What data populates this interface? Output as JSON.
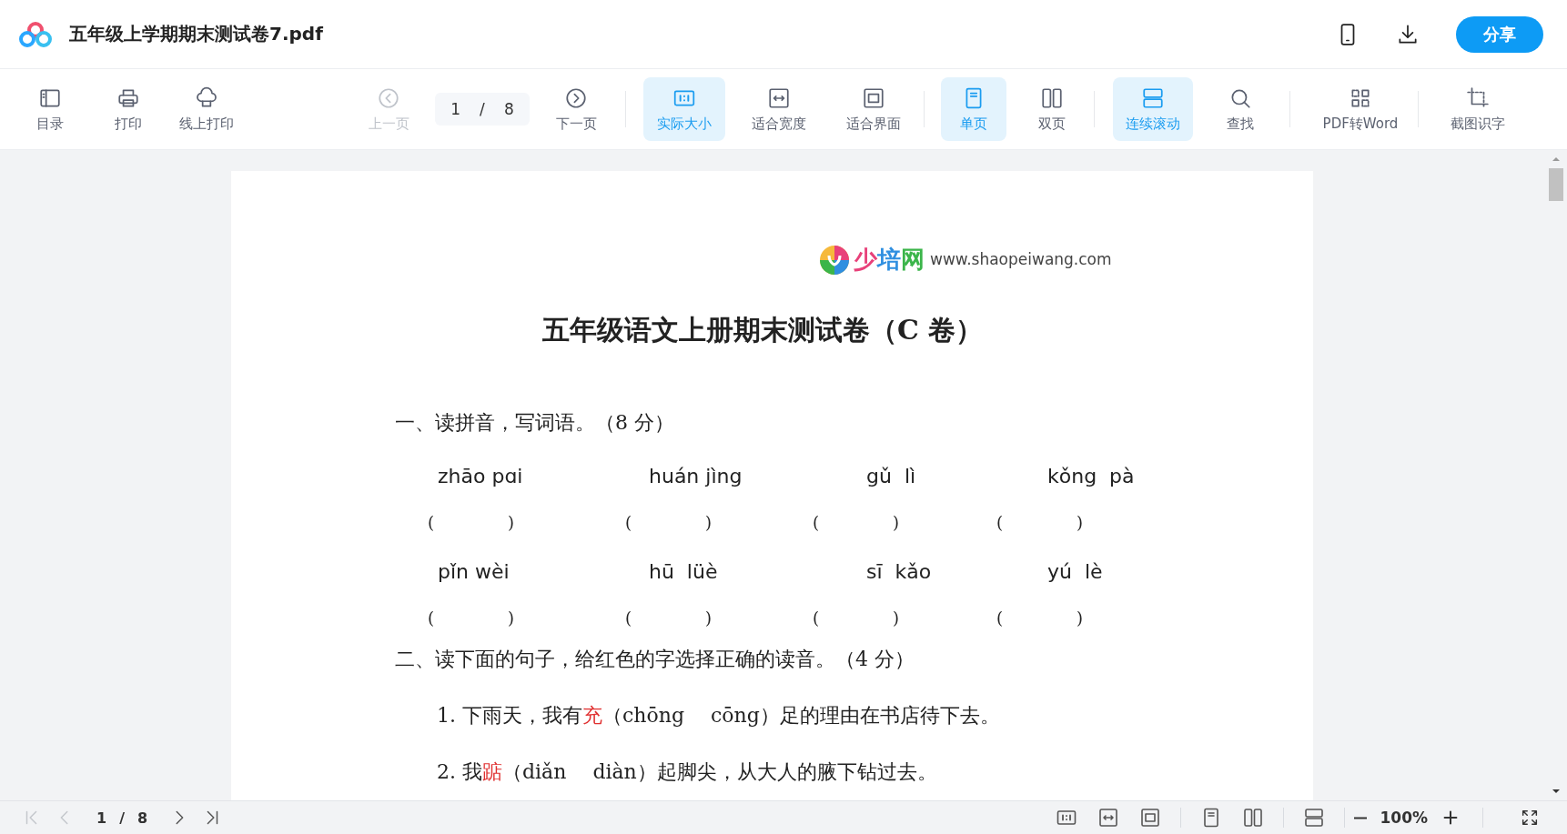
{
  "header": {
    "title": "五年级上学期期末测试卷7.pdf",
    "share_button": "分享"
  },
  "toolbar": {
    "groups": [
      [
        {
          "kind": "button",
          "label": "目录",
          "selected": false,
          "disabled": false
        },
        {
          "kind": "button",
          "label": "打印",
          "selected": false,
          "disabled": false
        },
        {
          "kind": "button",
          "label": "线上打印",
          "selected": false,
          "disabled": false
        }
      ],
      [
        {
          "kind": "button",
          "label": "上一页",
          "selected": false,
          "disabled": true
        },
        {
          "kind": "page-field",
          "current": "1",
          "separator": "/",
          "total": "8"
        },
        {
          "kind": "button",
          "label": "下一页",
          "selected": false,
          "disabled": false
        }
      ],
      [
        {
          "kind": "button",
          "label": "实际大小",
          "selected": true,
          "disabled": false
        },
        {
          "kind": "button",
          "label": "适合宽度",
          "selected": false,
          "disabled": false
        },
        {
          "kind": "button",
          "label": "适合界面",
          "selected": false,
          "disabled": false
        }
      ],
      [
        {
          "kind": "button",
          "label": "单页",
          "selected": true,
          "disabled": false
        },
        {
          "kind": "button",
          "label": "双页",
          "selected": false,
          "disabled": false
        }
      ],
      [
        {
          "kind": "button",
          "label": "连续滚动",
          "selected": true,
          "disabled": false
        },
        {
          "kind": "button",
          "label": "查找",
          "selected": false,
          "disabled": false
        }
      ],
      [
        {
          "kind": "button",
          "label": "PDF转Word",
          "selected": false,
          "disabled": false
        }
      ],
      [
        {
          "kind": "button",
          "label": "截图识字",
          "selected": false,
          "disabled": false
        }
      ]
    ]
  },
  "document": {
    "logo_text": "少培网",
    "logo_url": "www.shaopeiwang.com",
    "title": "五年级语文上册期末测试卷（C 卷）",
    "section_1": "一、读拼音，写词语。（8 分）",
    "pinyin_rows": [
      [
        {
          "pinyin": "zhāo pɑi",
          "answer": [
            "(",
            ")"
          ]
        },
        {
          "pinyin": "huán jìng",
          "answer": [
            "(",
            ")"
          ]
        },
        {
          "pinyin": "gǔ  lì",
          "answer": [
            "(",
            ")"
          ]
        },
        {
          "pinyin": "kǒng  pà",
          "answer": [
            "(",
            ")"
          ]
        }
      ],
      [
        {
          "pinyin": "pǐn wèi",
          "answer": [
            "(",
            ")"
          ]
        },
        {
          "pinyin": "hū  lüè",
          "answer": [
            "(",
            ")"
          ]
        },
        {
          "pinyin": "sī  kǎo",
          "answer": [
            "(",
            ")"
          ]
        },
        {
          "pinyin": "yú  lè",
          "answer": [
            "(",
            ")"
          ]
        }
      ]
    ],
    "section_2": "二、读下面的句子，给红色的字选择正确的读音。（4 分）",
    "sentences": [
      {
        "number": "1.",
        "before": "下雨天，我有",
        "highlight": "充",
        "after": "（chōng　 cōng）足的理由在书店待下去。"
      },
      {
        "number": "2.",
        "before": "我",
        "highlight": "踮",
        "after": "（diǎn　 diàn）起脚尖，从大人的腋下钻过去。"
      }
    ]
  },
  "statusbar": {
    "nav": [
      {
        "kind": "first",
        "disabled": true
      },
      {
        "kind": "prev",
        "disabled": true
      },
      {
        "kind": "next",
        "disabled": false
      },
      {
        "kind": "last",
        "disabled": false
      }
    ],
    "current": "1",
    "separator": "/",
    "total": "8",
    "view_buttons": [
      {
        "kind": "actual-size"
      },
      {
        "kind": "fit-width"
      },
      {
        "kind": "fit-page"
      },
      {
        "kind": "single-page"
      },
      {
        "kind": "double-page"
      },
      {
        "kind": "continuous"
      }
    ],
    "zoom": "100%"
  }
}
